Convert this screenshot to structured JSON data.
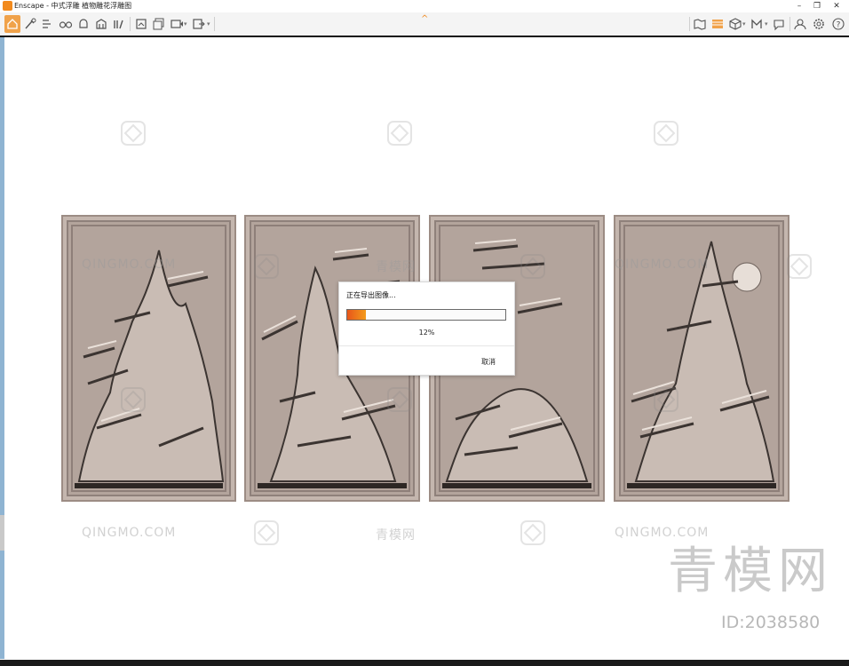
{
  "window": {
    "title": "Enscape - 中式浮雕 植物雕花浮雕图",
    "minimize": "–",
    "restore": "❐",
    "close": "✕"
  },
  "toolbar": {
    "left_tools": [
      "home-icon",
      "brush-icon",
      "settings-list-icon",
      "binoculars-icon",
      "bell-icon",
      "building-icon",
      "books-icon",
      "paint-roller-icon",
      "screenshot-export-icon",
      "batch-render-icon",
      "video-export-icon",
      "exe-export-icon"
    ],
    "right_tools": [
      "map-icon",
      "material-editor-icon",
      "asset-library-icon",
      "upload-icon",
      "feedback-icon",
      "account-icon",
      "settings-gear-icon",
      "help-icon"
    ],
    "active_tool": "home-icon",
    "accent": "#f08a1f",
    "collapse_icon": "^"
  },
  "panel_colors": {
    "stone": "#b3a49c",
    "shadow": "#3b3431",
    "highlight": "#eae1da"
  },
  "dialog": {
    "title": "正在导出图像...",
    "progress": 0.12,
    "progress_text": "12%",
    "cancel_label": "取消"
  },
  "watermark": {
    "brand_latin": "QINGMO.COM",
    "brand_cn": "青模网",
    "big_text": "青模网",
    "id_text": "ID:2038580"
  }
}
